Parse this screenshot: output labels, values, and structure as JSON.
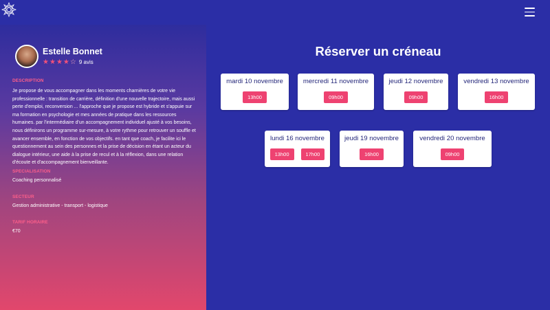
{
  "header": {
    "logo_icon": "mandala-logo-icon",
    "menu_icon": "hamburger-menu-icon"
  },
  "profile": {
    "name": "Estelle Bonnet",
    "rating": 4,
    "rating_max": 5,
    "reviews": "9 avis"
  },
  "sections": {
    "description_label": "DESCRIPTION",
    "description_text": "Je propose de vous accompagner dans les moments charnières de votre vie professionnelle : transition de carrière, définition d'une nouvelle trajectoire, mais aussi perte d'emploi, reconversion ... l'approche que je propose est hybride et s'appuie sur ma formation en psychologie et mes années de pratique dans les ressources humaines. par l'intermédiaire d'un accompagnement individuel ajusté à vos besoins, nous définirons un programme sur-mesure, à votre rythme pour retrouver un souffle et avancer ensemble, en fonction de vos objectifs. en tant que coach, je facilite ici le questionnement au sein des personnes et la prise de décision en étant un acteur du dialogue intérieur, une aide à la prise de recul et à la réflexion, dans une relation d'écoute et d'accompagnement bienveillante.",
    "specialisation_label": "SPECIALISATION",
    "specialisation_text": "Coaching personnalisé",
    "secteur_label": "SECTEUR",
    "secteur_text": "Gestion administrative - transport - logistique",
    "tarif_label": "TARIF HORAIRE",
    "tarif_text": "€70"
  },
  "booking": {
    "title": "Réserver un créneau",
    "days": [
      {
        "label": "mardi 10 novembre",
        "slots": [
          "13h00"
        ]
      },
      {
        "label": "mercredi 11 novembre",
        "slots": [
          "09h00"
        ]
      },
      {
        "label": "jeudi 12 novembre",
        "slots": [
          "09h00"
        ]
      },
      {
        "label": "vendredi 13 novembre",
        "slots": [
          "16h00"
        ]
      },
      {
        "label": "lundi 16 novembre",
        "slots": [
          "13h00",
          "17h00"
        ]
      },
      {
        "label": "jeudi 19 novembre",
        "slots": [
          "16h00"
        ]
      },
      {
        "label": "vendredi 20 novembre",
        "slots": [
          "09h00"
        ]
      }
    ]
  },
  "colors": {
    "background": "#2b2ea6",
    "accent": "#ee4271",
    "label": "#ff5f8a"
  }
}
